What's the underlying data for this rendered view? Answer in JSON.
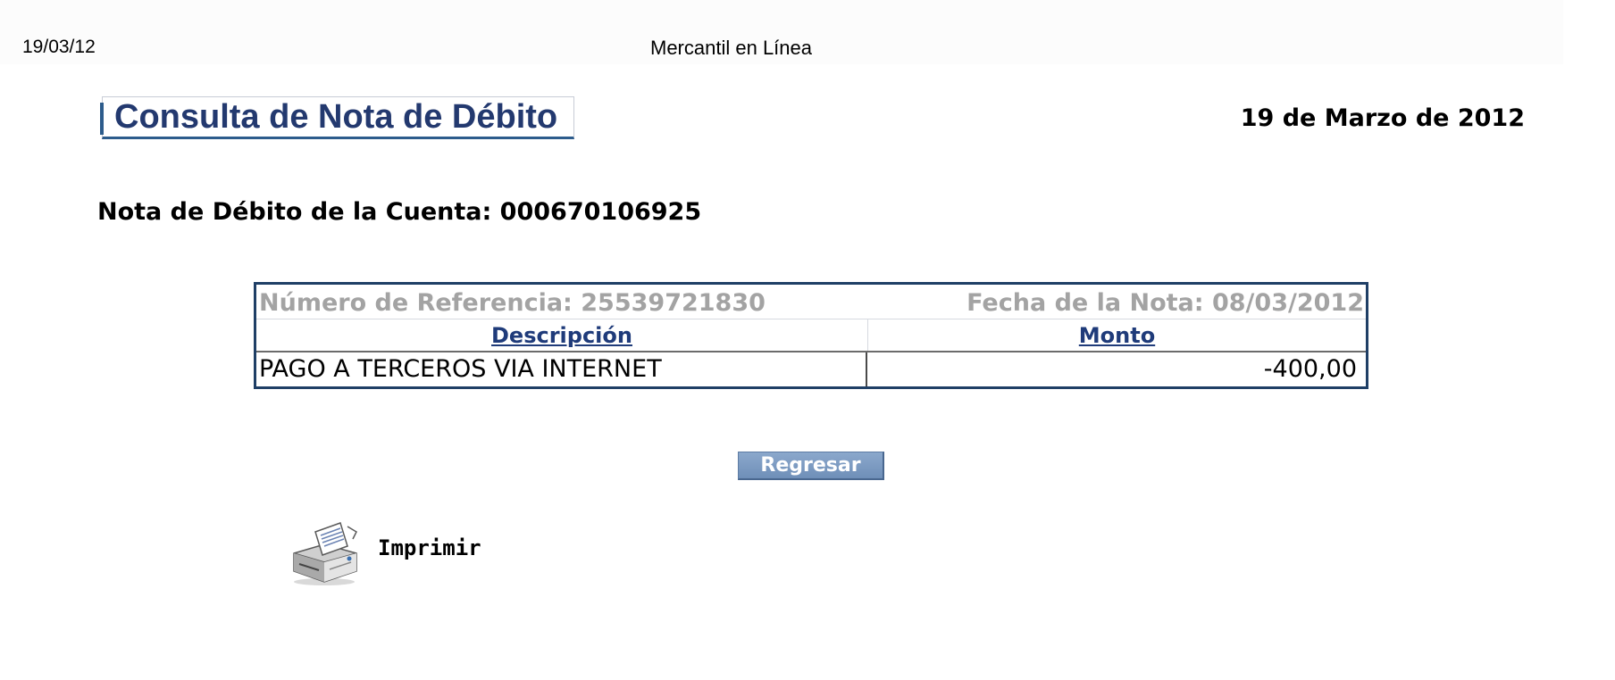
{
  "print_header": {
    "date": "19/03/12",
    "site_name": "Mercantil en Línea"
  },
  "page": {
    "title": "Consulta de Nota de Débito",
    "date": "19 de Marzo de 2012",
    "account_line": "Nota de Débito de la Cuenta: 000670106925"
  },
  "note_table": {
    "reference": "Número de Referencia: 25539721830",
    "note_date": "Fecha de la Nota: 08/03/2012",
    "columns": [
      "Descripción",
      "Monto"
    ],
    "rows": [
      {
        "descripcion": "PAGO A TERCEROS VIA INTERNET",
        "monto": "-400,00"
      }
    ]
  },
  "actions": {
    "back_label": "Regresar",
    "print_label": "Imprimir",
    "print_icon": "printer-icon"
  },
  "colors": {
    "title": "#23396f",
    "header_link": "#1f3b7a",
    "muted": "#a3a3a3",
    "table_border": "#1f3f66",
    "button": "#7b98c0"
  }
}
